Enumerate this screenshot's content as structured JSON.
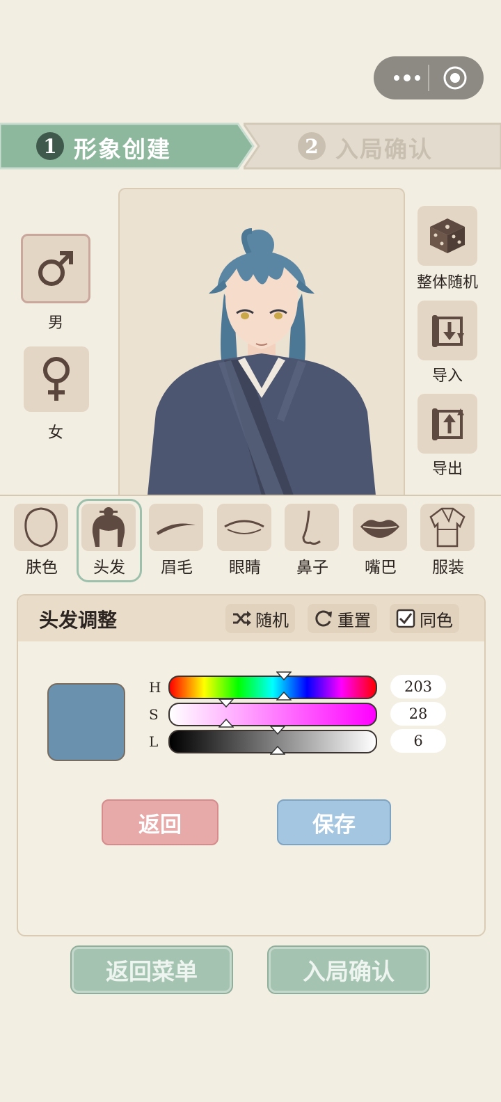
{
  "steps": [
    {
      "number": "1",
      "label": "形象创建",
      "active": true
    },
    {
      "number": "2",
      "label": "入局确认",
      "active": false
    }
  ],
  "gender": {
    "male_label": "男",
    "female_label": "女",
    "selected": "male"
  },
  "side_actions": {
    "random_all": "整体随机",
    "import": "导入",
    "export": "导出"
  },
  "features": [
    {
      "label": "肤色",
      "icon": "face-outline-icon"
    },
    {
      "label": "头发",
      "icon": "hair-icon",
      "selected": true
    },
    {
      "label": "眉毛",
      "icon": "eyebrow-icon"
    },
    {
      "label": "眼睛",
      "icon": "eye-icon"
    },
    {
      "label": "鼻子",
      "icon": "nose-icon"
    },
    {
      "label": "嘴巴",
      "icon": "lips-icon"
    },
    {
      "label": "服装",
      "icon": "robe-icon"
    }
  ],
  "panel": {
    "title": "头发调整",
    "random_label": "随机",
    "reset_label": "重置",
    "same_color_label": "同色",
    "same_color_checked": true,
    "swatch_color": "#6a91ae",
    "h_label": "H",
    "s_label": "S",
    "l_label": "L",
    "h_value": "203",
    "s_value": "28",
    "l_value": "6",
    "h_fraction": 0.56,
    "s_fraction": 0.28,
    "l_fraction": 0.53,
    "back_label": "返回",
    "save_label": "保存"
  },
  "footer": {
    "menu_label": "返回菜单",
    "confirm_label": "入局确认"
  },
  "colors": {
    "active_step": "#8db89d",
    "inactive_step": "#e3dbcd",
    "hair": "#5b86a3",
    "robe": "#4d5670"
  }
}
